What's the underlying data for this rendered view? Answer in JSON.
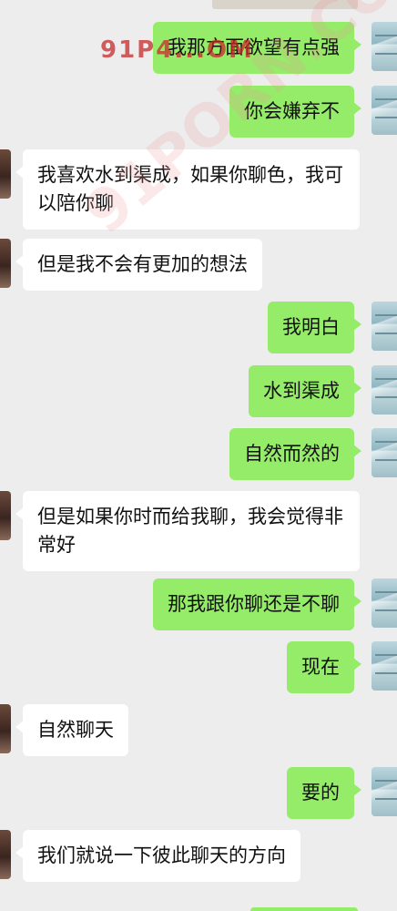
{
  "watermark": {
    "small": "91P4...OM",
    "large": "91PORN.COM"
  },
  "messages": [
    {
      "side": "right",
      "text": "我那方面欲望有点强"
    },
    {
      "side": "right",
      "text": "你会嫌弃不"
    },
    {
      "side": "left",
      "text": "我喜欢水到渠成，如果你聊色，我可以陪你聊"
    },
    {
      "side": "left",
      "text": "但是我不会有更加的想法"
    },
    {
      "side": "right",
      "text": "我明白"
    },
    {
      "side": "right",
      "text": "水到渠成"
    },
    {
      "side": "right",
      "text": "自然而然的"
    },
    {
      "side": "left",
      "text": "但是如果你时而给我聊，我会觉得非常好"
    },
    {
      "side": "right",
      "text": "那我跟你聊还是不聊"
    },
    {
      "side": "right",
      "text": "现在"
    },
    {
      "side": "left",
      "text": "自然聊天"
    },
    {
      "side": "right",
      "text": "要的"
    },
    {
      "side": "left",
      "text": "我们就说一下彼此聊天的方向"
    }
  ],
  "colors": {
    "background": "#ededed",
    "self_bubble": "#95ec69",
    "other_bubble": "#ffffff",
    "watermark": "#c82828"
  }
}
